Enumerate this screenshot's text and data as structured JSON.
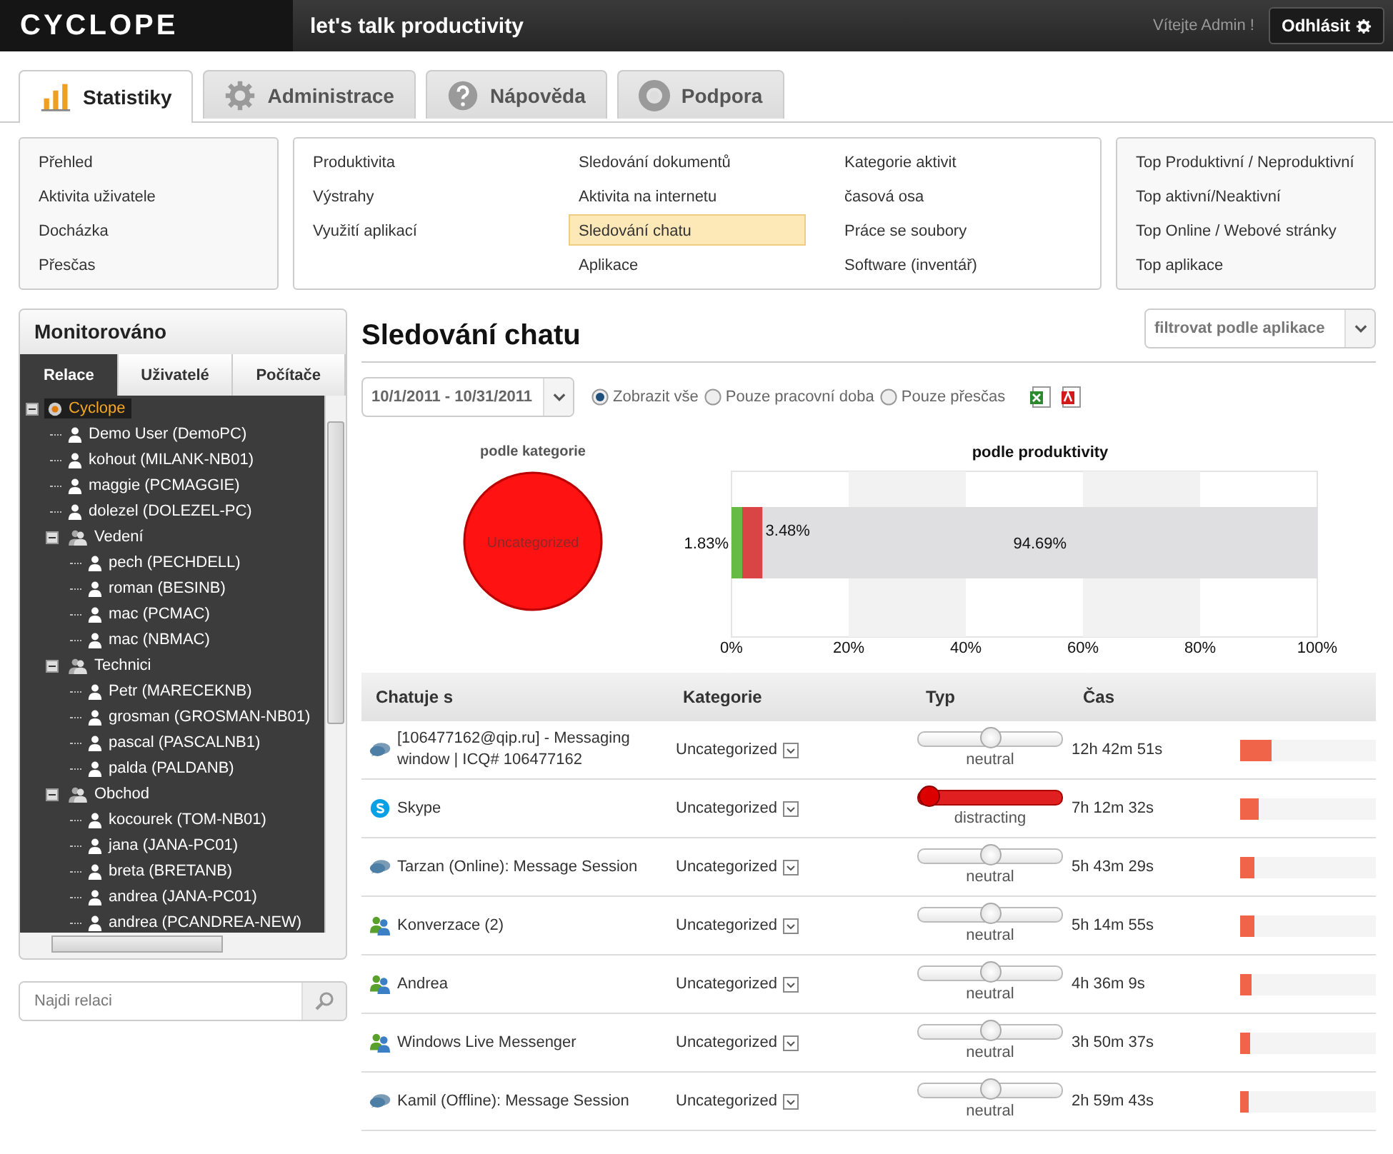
{
  "header": {
    "logo": "CYCLOPE",
    "tagline": "let's talk productivity",
    "welcome": "Vítejte Admin !",
    "logout": "Odhlásit"
  },
  "tabs": [
    {
      "label": "Statistiky",
      "kind": "stats",
      "selected": true
    },
    {
      "label": "Administrace",
      "kind": "gear",
      "selected": false
    },
    {
      "label": "Nápověda",
      "kind": "help",
      "selected": false
    },
    {
      "label": "Podpora",
      "kind": "support",
      "selected": false
    }
  ],
  "submenus": [
    {
      "columns": [
        [
          {
            "label": "Přehled",
            "selected": false
          },
          {
            "label": "Aktivita uživatele",
            "selected": false
          },
          {
            "label": "Docházka",
            "selected": false
          },
          {
            "label": "Přesčas",
            "selected": false
          }
        ]
      ]
    },
    {
      "columns": [
        [
          {
            "label": "Produktivita",
            "selected": false
          },
          {
            "label": "Výstrahy",
            "selected": false
          },
          {
            "label": "Využití aplikací",
            "selected": false
          }
        ],
        [
          {
            "label": "Sledování dokumentů",
            "selected": false
          },
          {
            "label": "Aktivita na internetu",
            "selected": false
          },
          {
            "label": "Sledování chatu",
            "selected": true
          },
          {
            "label": "Aplikace",
            "selected": false
          }
        ],
        [
          {
            "label": "Kategorie aktivit",
            "selected": false
          },
          {
            "label": "časová osa",
            "selected": false
          },
          {
            "label": "Práce se soubory",
            "selected": false
          },
          {
            "label": "Software (inventář)",
            "selected": false
          }
        ]
      ]
    },
    {
      "columns": [
        [
          {
            "label": "Top Produktivní / Neproduktivní",
            "selected": false
          },
          {
            "label": "Top aktivní/Neaktivní",
            "selected": false
          },
          {
            "label": "Top Online / Webové stránky",
            "selected": false
          },
          {
            "label": "Top aplikace",
            "selected": false
          }
        ]
      ]
    }
  ],
  "sidebar": {
    "title": "Monitorováno",
    "tabs": [
      {
        "label": "Relace",
        "selected": true
      },
      {
        "label": "Uživatelé",
        "selected": false
      },
      {
        "label": "Počítače",
        "selected": false
      }
    ],
    "tree": [
      {
        "label": "Cyclope",
        "kind": "root",
        "selected": true,
        "expanded": true,
        "children": [
          {
            "label": "Demo User (DemoPC)",
            "kind": "user",
            "selected": false
          },
          {
            "label": "kohout (MILANK-NB01)",
            "kind": "user",
            "selected": false
          },
          {
            "label": "maggie (PCMAGGIE)",
            "kind": "user",
            "selected": false
          },
          {
            "label": "dolezel (DOLEZEL-PC)",
            "kind": "user",
            "selected": false
          },
          {
            "label": "Vedení",
            "kind": "group",
            "selected": false,
            "expanded": true,
            "children": [
              {
                "label": "pech (PECHDELL)",
                "kind": "user",
                "selected": false
              },
              {
                "label": "roman (BESINB)",
                "kind": "user",
                "selected": false
              },
              {
                "label": "mac (PCMAC)",
                "kind": "user",
                "selected": false
              },
              {
                "label": "mac (NBMAC)",
                "kind": "user",
                "selected": false
              }
            ]
          },
          {
            "label": "Technici",
            "kind": "group",
            "selected": false,
            "expanded": true,
            "children": [
              {
                "label": "Petr (MARECEKNB)",
                "kind": "user",
                "selected": false
              },
              {
                "label": "grosman (GROSMAN-NB01)",
                "kind": "user",
                "selected": false
              },
              {
                "label": "pascal (PASCALNB1)",
                "kind": "user",
                "selected": false
              },
              {
                "label": "palda (PALDANB)",
                "kind": "user",
                "selected": false
              }
            ]
          },
          {
            "label": "Obchod",
            "kind": "group",
            "selected": false,
            "expanded": true,
            "children": [
              {
                "label": "kocourek (TOM-NB01)",
                "kind": "user",
                "selected": false
              },
              {
                "label": "jana (JANA-PC01)",
                "kind": "user",
                "selected": false
              },
              {
                "label": "breta (BRETANB)",
                "kind": "user",
                "selected": false
              },
              {
                "label": "andrea (JANA-PC01)",
                "kind": "user",
                "selected": false
              },
              {
                "label": "andrea (PCANDREA-NEW)",
                "kind": "user",
                "selected": false
              }
            ]
          }
        ]
      }
    ],
    "search": {
      "placeholder": "Najdi relaci"
    }
  },
  "main": {
    "title": "Sledování chatu",
    "filter": {
      "placeholder": "filtrovat podle aplikace"
    },
    "date_range": "10/1/2011 - 10/31/2011",
    "options": [
      {
        "label": "Zobrazit vše",
        "selected": true
      },
      {
        "label": "Pouze pracovní doba",
        "selected": false
      },
      {
        "label": "Pouze přesčas",
        "selected": false
      }
    ],
    "pie": {
      "chart_data": {
        "type": "pie",
        "title": "podle kategorie",
        "categories": [
          "Uncategorized"
        ],
        "values": [
          100
        ]
      }
    },
    "bar": {
      "chart_data": {
        "type": "bar",
        "title": "podle produktivity",
        "orientation": "horizontal",
        "stacked": true,
        "series": [
          {
            "color": "#66bb44",
            "values": [
              1.83
            ]
          },
          {
            "color": "#d94444",
            "values": [
              3.48
            ]
          },
          {
            "color": "#dfdfe1",
            "values": [
              94.69
            ]
          }
        ],
        "xlim": [
          0,
          100
        ],
        "xticks": [
          {
            "value": 0,
            "label": "0%"
          },
          {
            "value": 20,
            "label": "20%"
          },
          {
            "value": 40,
            "label": "40%"
          },
          {
            "value": 60,
            "label": "60%"
          },
          {
            "value": 80,
            "label": "80%"
          },
          {
            "value": 100,
            "label": "100%"
          }
        ],
        "value_labels": [
          "1.83%",
          "3.48%",
          "94.69%"
        ]
      }
    },
    "table": {
      "columns": [
        "Chatuje s",
        "Kategorie",
        "Typ",
        "Čas"
      ],
      "rows": [
        {
          "kind": "chat",
          "name": "[106477162@qip.ru] - Messaging window | ICQ# 106477162",
          "category": "Uncategorized",
          "level": 0.5,
          "type": "neutral",
          "time": "12h 42m 51s",
          "bar": {
            "level": 0.23
          }
        },
        {
          "kind": "skype",
          "name": "Skype",
          "category": "Uncategorized",
          "level": 0,
          "type": "distracting",
          "time": "7h 12m 32s",
          "bar": {
            "level": 0.14
          }
        },
        {
          "kind": "chat",
          "name": "Tarzan (Online): Message Session",
          "category": "Uncategorized",
          "level": 0.5,
          "type": "neutral",
          "time": "5h 43m 29s",
          "bar": {
            "level": 0.11
          }
        },
        {
          "kind": "messenger",
          "name": "Konverzace (2)",
          "category": "Uncategorized",
          "level": 0.5,
          "type": "neutral",
          "time": "5h 14m 55s",
          "bar": {
            "level": 0.1
          }
        },
        {
          "kind": "messenger",
          "name": "Andrea",
          "category": "Uncategorized",
          "level": 0.5,
          "type": "neutral",
          "time": "4h 36m 9s",
          "bar": {
            "level": 0.085
          }
        },
        {
          "kind": "messenger",
          "name": "Windows Live Messenger",
          "category": "Uncategorized",
          "level": 0.5,
          "type": "neutral",
          "time": "3h 50m 37s",
          "bar": {
            "level": 0.075
          }
        },
        {
          "kind": "chat",
          "name": "Kamil (Offline): Message Session",
          "category": "Uncategorized",
          "level": 0.5,
          "type": "neutral",
          "time": "2h 59m 43s",
          "bar": {
            "level": 0.065
          }
        }
      ]
    }
  }
}
